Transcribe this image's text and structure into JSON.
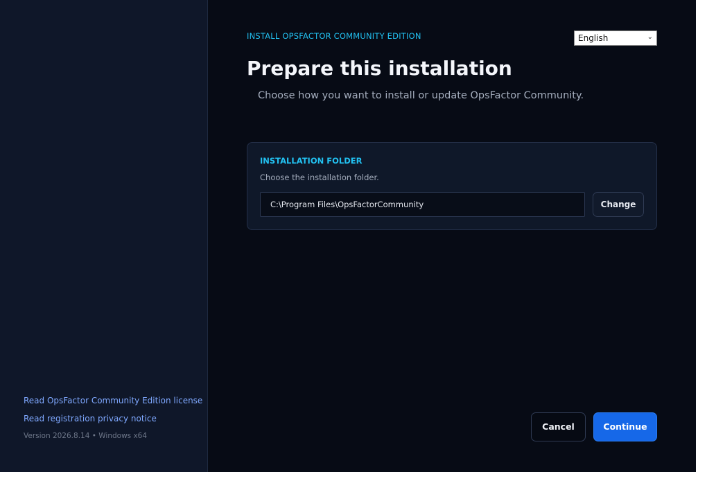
{
  "sidebar": {
    "links": [
      {
        "label": "Read OpsFactor Community Edition license"
      },
      {
        "label": "Read registration privacy notice"
      }
    ],
    "version": "Version 2026.8.14 • Windows x64"
  },
  "header": {
    "eyebrow": "INSTALL OPSFACTOR COMMUNITY EDITION",
    "title": "Prepare this installation",
    "subtitle": "Choose how you want to install or update OpsFactor Community."
  },
  "language": {
    "selected": "English",
    "icon": "chevron-down-icon"
  },
  "install_folder": {
    "title": "INSTALLATION FOLDER",
    "description": "Choose the installation folder.",
    "path": "C:\\Program Files\\OpsFactorCommunity",
    "change_label": "Change"
  },
  "footer": {
    "cancel_label": "Cancel",
    "continue_label": "Continue"
  },
  "colors": {
    "accent": "#22c1f1",
    "primary_button": "#1668e8",
    "link": "#7fa8ff",
    "background": "#070b15",
    "sidebar": "#0f1729"
  }
}
